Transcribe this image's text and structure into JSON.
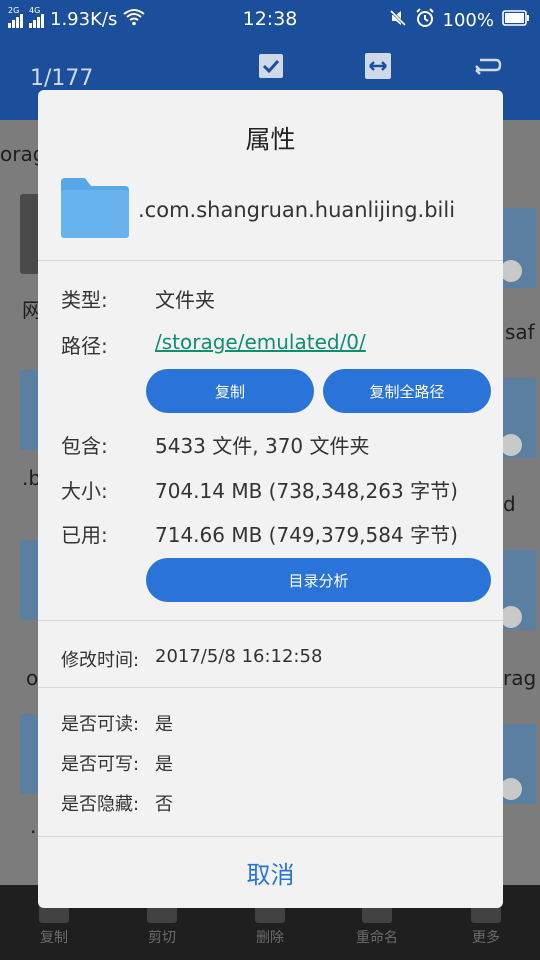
{
  "status": {
    "network_small": "2G",
    "network_small2": "4G",
    "speed": "1.93K/s",
    "time": "12:38",
    "battery": "100%"
  },
  "appbar": {
    "count": "1/177",
    "icons": [
      "checkbox-icon",
      "swap-icon",
      "back-icon"
    ]
  },
  "background": {
    "fragments": [
      "orag",
      "网",
      "saf",
      ".b",
      "d",
      "o",
      "rag",
      "."
    ]
  },
  "bottom_bar": {
    "items": [
      "复制",
      "剪切",
      "删除",
      "重命名",
      "更多"
    ]
  },
  "dialog": {
    "title": "属性",
    "folder_name": ".com.shangruan.huanlijing.bili",
    "type_label": "类型:",
    "type_value": "文件夹",
    "path_label": "路径:",
    "path_value": "/storage/emulated/0/",
    "copy_button": "复制",
    "copy_full_path_button": "复制全路径",
    "contains_label": "包含:",
    "contains_value": "5433 文件, 370 文件夹",
    "size_label": "大小:",
    "size_value": "704.14 MB (738,348,263 字节)",
    "used_label": "已用:",
    "used_value": "714.66 MB (749,379,584 字节)",
    "analyze_button": "目录分析",
    "modified_label": "修改时间:",
    "modified_value": "2017/5/8 16:12:58",
    "readable_label": "是否可读:",
    "readable_value": "是",
    "writable_label": "是否可写:",
    "writable_value": "是",
    "hidden_label": "是否隐藏:",
    "hidden_value": "否",
    "cancel_button": "取消"
  },
  "colors": {
    "accent": "#2a73d9",
    "link": "#0f8e72",
    "appbar": "#1c4f9b",
    "folder": "#5aa7e8"
  }
}
